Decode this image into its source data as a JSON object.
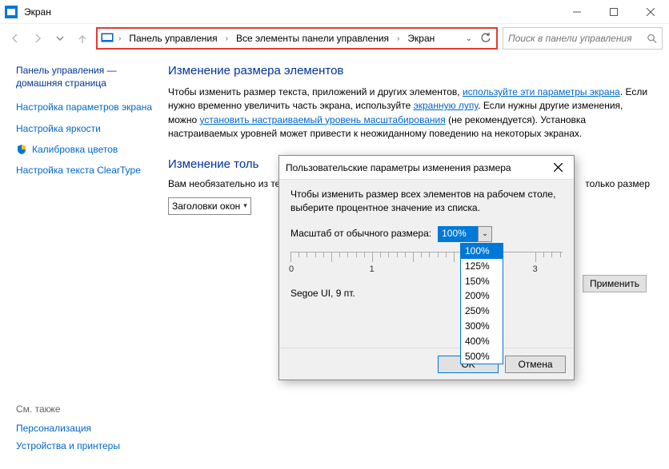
{
  "titlebar": {
    "title": "Экран"
  },
  "breadcrumbs": {
    "c0": "Панель управления",
    "c1": "Все элементы панели управления",
    "c2": "Экран"
  },
  "search": {
    "placeholder": "Поиск в панели управления"
  },
  "sidebar": {
    "home": "Панель управления — домашняя страница",
    "l0": "Настройка параметров экрана",
    "l1": "Настройка яркости",
    "l2": "Калибровка цветов",
    "l3": "Настройка текста ClearType"
  },
  "main": {
    "h1": "Изменение размера элементов",
    "p1a": "Чтобы изменить размер текста, приложений и других элементов, ",
    "p1link1": "используйте эти параметры экрана",
    "p1b": ". Если нужно временно увеличить часть экрана, используйте ",
    "p1link2": "экранную лупу",
    "p1c": ". Если нужны другие изменения, можно ",
    "p1link3": "установить настраиваемый уровень масштабирования",
    "p1d": " (не рекомендуется). Установка настраиваемых уровней может привести к неожиданному поведению на некоторых экранах.",
    "h2": "Изменение толь",
    "p2": "Вам необязательно из текста определенного",
    "p2b": "только размер",
    "combo": "Заголовки окон",
    "apply": "Применить"
  },
  "dialog": {
    "title": "Пользовательские параметры изменения размера",
    "instr": "Чтобы изменить размер всех элементов на рабочем столе, выберите процентное значение из списка.",
    "label": "Масштаб от обычного размера:",
    "value": "100%",
    "options": [
      "100%",
      "125%",
      "150%",
      "200%",
      "250%",
      "300%",
      "400%",
      "500%"
    ],
    "ruler": {
      "n0": "0",
      "n1": "1",
      "n3": "3"
    },
    "sample": "Segoe UI, 9 пт.",
    "ok": "OK",
    "cancel": "Отмена"
  },
  "seealso": {
    "hdr": "См. также",
    "l0": "Персонализация",
    "l1": "Устройства и принтеры"
  }
}
